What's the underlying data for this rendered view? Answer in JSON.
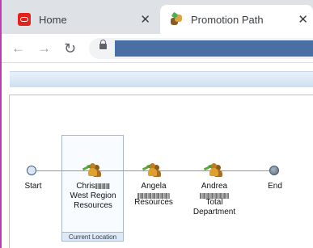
{
  "browser": {
    "tabs": [
      {
        "title": "Home",
        "icon": "oracle-logo-icon",
        "close": "✕"
      },
      {
        "title": "Promotion Path",
        "icon": "promotion-path-icon",
        "close": "✕"
      }
    ],
    "nav": {
      "back": "←",
      "forward": "→",
      "reload": "↻"
    }
  },
  "flow": {
    "start_label": "Start",
    "end_label": "End",
    "current_location": "Current Location",
    "nodes": [
      {
        "name": "Chris",
        "line2": "West Region",
        "line3": "Resources"
      },
      {
        "name": "Angela",
        "line2": "Resources",
        "line3": ""
      },
      {
        "name": "Andrea",
        "line2": "Total",
        "line3": "Department"
      }
    ]
  }
}
